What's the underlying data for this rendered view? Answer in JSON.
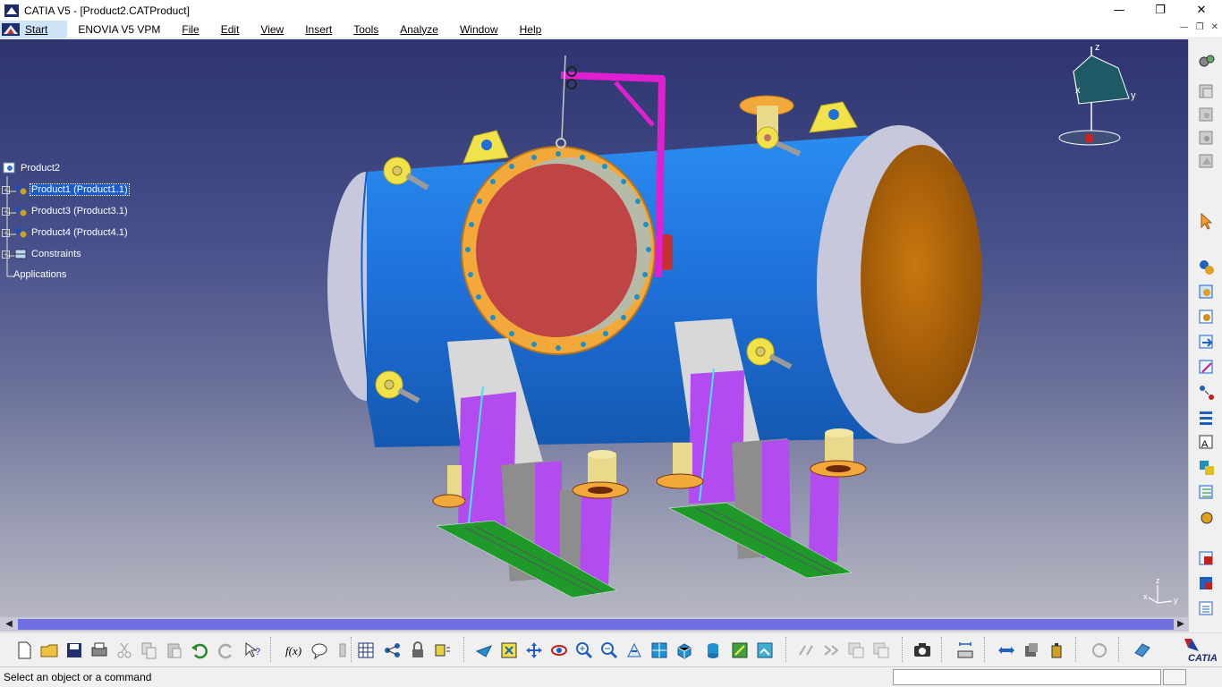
{
  "window": {
    "title": "CATIA V5 - [Product2.CATProduct]",
    "controls": {
      "minimize": "—",
      "maximize": "❐",
      "close": "✕"
    }
  },
  "menubar": {
    "start": "Start",
    "items": [
      "ENOVIA V5 VPM",
      "File",
      "Edit",
      "View",
      "Insert",
      "Tools",
      "Analyze",
      "Window",
      "Help"
    ],
    "mdi_controls": {
      "minimize": "—",
      "restore": "❐",
      "close": "✕"
    }
  },
  "tree": {
    "root": "Product2",
    "children": [
      {
        "label": "Product1 (Product1.1)",
        "selected": true,
        "icon": "product-icon"
      },
      {
        "label": "Product3 (Product3.1)",
        "selected": false,
        "icon": "product-icon"
      },
      {
        "label": "Product4 (Product4.1)",
        "selected": false,
        "icon": "product-icon"
      },
      {
        "label": "Constraints",
        "selected": false,
        "icon": "constraints-icon"
      }
    ],
    "applications": "Applications"
  },
  "compass": {
    "z": "z",
    "x": "x",
    "y": "y"
  },
  "triad": {
    "z": "z",
    "x": "x",
    "y": "y"
  },
  "scrollbar": {
    "left_arrow": "◀",
    "right_arrow": "▶"
  },
  "statusbar": {
    "message": "Select an object or a command",
    "command_input": ""
  },
  "brand": {
    "logo_text": "CATIA"
  },
  "colors": {
    "vessel_shell": "#1e78e0",
    "head_cap": "#c8c8dc",
    "end_face": "#b8660a",
    "flange_ring": "#f2a93a",
    "manway_cover": "#bf4545",
    "saddle_plate": "#b24cf0",
    "base_plate": "#1f9a2a",
    "davit": "#e020d0",
    "lug": "#f2e24a",
    "nozzle": "#d6c86c"
  },
  "icons": {
    "right_toolbar": [
      "gears-icon",
      "product-structure-icon",
      "new-component-icon",
      "new-product-icon",
      "new-part-icon",
      "select-arrow-icon",
      "replace-component-icon",
      "graph-tree-icon",
      "generate-numbering-icon",
      "manipulate-icon",
      "snap-icon",
      "explode-icon",
      "stop-clash-icon",
      "coincidence-constraint-icon",
      "contact-constraint-icon",
      "offset-constraint-icon",
      "fix-component-icon",
      "update-icon",
      "bill-of-material-icon",
      "publication-icon"
    ],
    "bottom_toolbar": [
      "new-icon",
      "open-icon",
      "save-icon",
      "print-icon",
      "cut-icon",
      "copy-icon",
      "paste-icon",
      "undo-icon",
      "redo-icon",
      "whats-this-icon",
      "formula-icon",
      "knowledge-icon",
      "catalog-icon",
      "table-icon",
      "scene-icon",
      "lock-icon",
      "measure-icon",
      "fly-icon",
      "fit-all-icon",
      "pan-icon",
      "rotate-icon",
      "zoom-in-icon",
      "zoom-out-icon",
      "normal-view-icon",
      "multi-view-icon",
      "isometric-view-icon",
      "shading-icon",
      "render-style-icon",
      "hide-show-icon",
      "swap-space-icon",
      "capture-icon",
      "sectioning-icon",
      "clash-icon",
      "distance-icon",
      "space-analysis-icon",
      "update-all-icon",
      "sheet-icon"
    ]
  }
}
